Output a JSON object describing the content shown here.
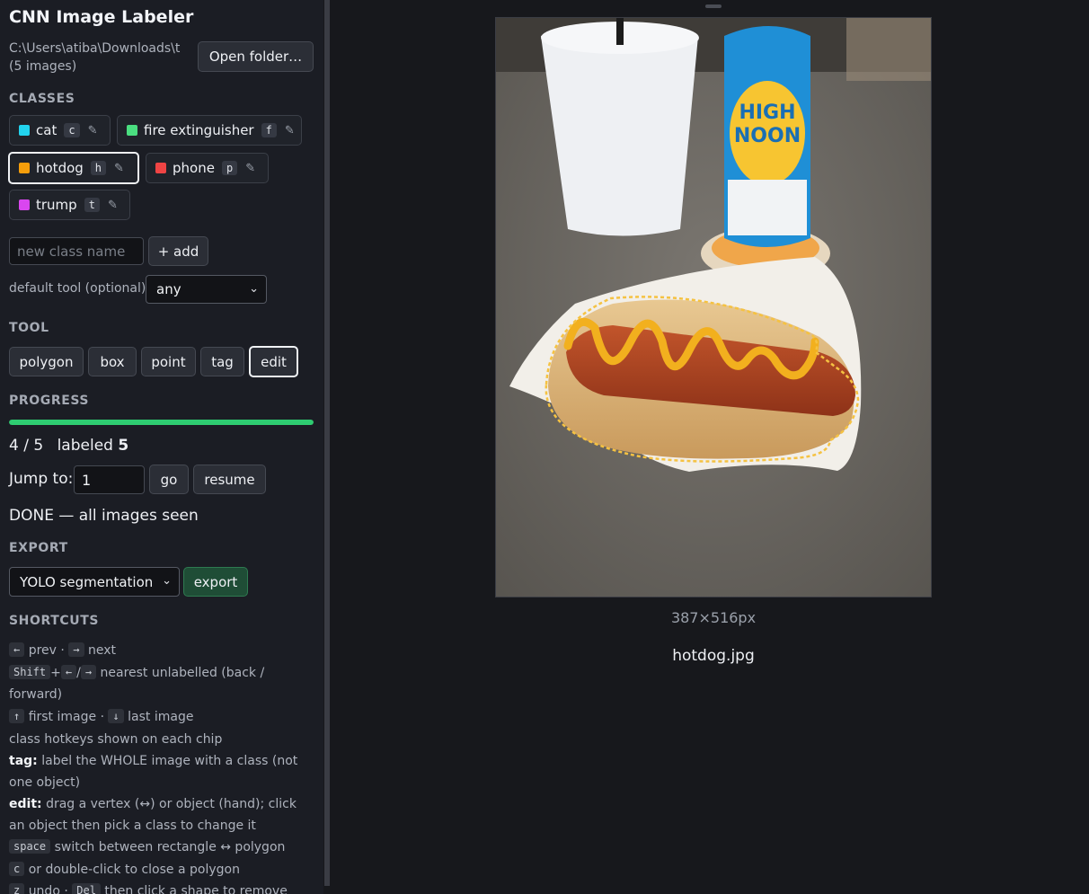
{
  "app": {
    "title": "CNN Image Labeler"
  },
  "folder": {
    "path": "C:\\Users\\atiba\\Downloads\\t (5 images)",
    "open_label": "Open folder…"
  },
  "classes": {
    "heading": "CLASSES",
    "items": [
      {
        "name": "cat",
        "hotkey": "c",
        "color": "#22d3ee",
        "edit_icon": "pencil-icon"
      },
      {
        "name": "fire extinguisher",
        "hotkey": "f",
        "color": "#4ade80",
        "edit_icon": "pencil-icon"
      },
      {
        "name": "hotdog",
        "hotkey": "h",
        "color": "#f59e0b",
        "edit_icon": "pencil-icon",
        "active": true
      },
      {
        "name": "phone",
        "hotkey": "p",
        "color": "#ef4444",
        "edit_icon": "pencil-icon"
      },
      {
        "name": "trump",
        "hotkey": "t",
        "color": "#d946ef",
        "edit_icon": "pencil-icon"
      }
    ],
    "new_placeholder": "new class name",
    "add_label": "+ add",
    "default_tool_label": "default tool (optional):",
    "default_tool_value": "any"
  },
  "tool": {
    "heading": "TOOL",
    "items": [
      "polygon",
      "box",
      "point",
      "tag",
      "edit"
    ],
    "active": "edit"
  },
  "progress": {
    "heading": "PROGRESS",
    "fraction": 1.0,
    "position_text": "4 / 5",
    "labeled_text": "labeled",
    "labeled_count": "5",
    "jump_label": "Jump to:",
    "jump_value": "1",
    "go_label": "go",
    "resume_label": "resume",
    "status": "DONE — all images seen"
  },
  "export": {
    "heading": "EXPORT",
    "format": "YOLO segmentation",
    "button": "export"
  },
  "shortcuts": {
    "heading": "SHORTCUTS",
    "k_left": "←",
    "prev": "prev",
    "dot1": "·",
    "k_right": "→",
    "next": "next",
    "k_shift": "Shift",
    "plus": "+",
    "k_left2": "←",
    "slash": "/",
    "k_right2": "→",
    "nearest": "nearest unlabelled (back / forward)",
    "k_up": "↑",
    "first": "first image",
    "dot2": "·",
    "k_down": "↓",
    "last": "last image",
    "chip_hotkeys": "class hotkeys shown on each chip",
    "tag_b": "tag:",
    "tag_text": "label the WHOLE image with a class (not one object)",
    "edit_b": "edit:",
    "edit_text": "drag a vertex (↔) or object (hand); click an object then pick a class to change it",
    "k_space": "space",
    "space_text": "switch between rectangle ↔ polygon",
    "k_c": "c",
    "c_text": "or double-click to close a polygon",
    "k_z": "z",
    "undo": "undo ·",
    "k_del": "Del",
    "del_text": "then click a shape to remove"
  },
  "canvas": {
    "dimensions": "387×516px",
    "filename": "hotdog.jpg",
    "annotation_class": "hotdog",
    "annotation_color": "#f5c242"
  }
}
